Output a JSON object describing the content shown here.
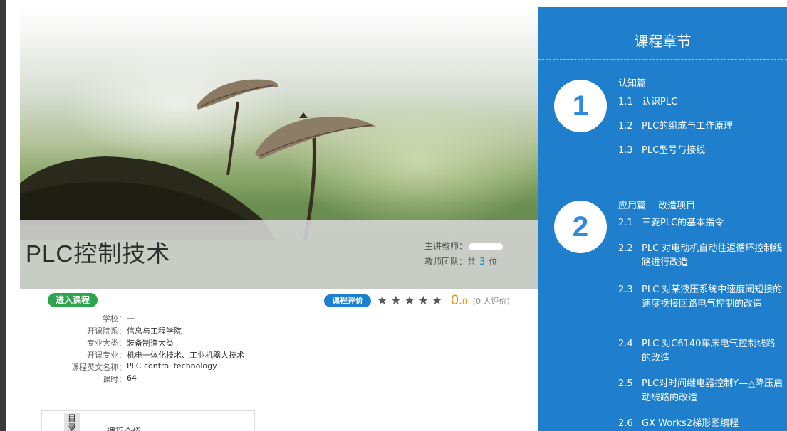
{
  "course": {
    "title": "PLC控制技术",
    "teacher_label": "主讲教师：",
    "team_prefix": "教师团队：共",
    "team_count": "3",
    "team_suffix": "位",
    "enter_label": "进入课程"
  },
  "rating": {
    "badge": "课程评价",
    "stars": "★★★★★",
    "score_main": "0.",
    "score_decimal": "0",
    "count": "(0 人评价)"
  },
  "info": {
    "school_label": "学校：",
    "school_value": "一",
    "dept_label": "开课院系：",
    "dept_value": "信息与工程学院",
    "category_label": "专业大类：",
    "category_value": "装备制造大类",
    "major_label": "开课专业：",
    "major_value": "机电一体化技术、工业机器人技术",
    "english_label": "课程英文名称：",
    "english_value": "PLC control technology",
    "hours_label": "课时：",
    "hours_value": "64"
  },
  "toc": {
    "tab_label": "目录",
    "intro_label": "课程介绍"
  },
  "chapters": {
    "heading": "课程章节",
    "sections": [
      {
        "number": "1",
        "title": "认知篇",
        "items": [
          {
            "no": "1.1",
            "text": "认识PLC"
          },
          {
            "no": "1.2",
            "text": "PLC的组成与工作原理"
          },
          {
            "no": "1.3",
            "text": "PLC型号与接线"
          }
        ]
      },
      {
        "number": "2",
        "title": "应用篇 —改造项目",
        "items": [
          {
            "no": "2.1",
            "text": "三菱PLC的基本指令"
          },
          {
            "no": "2.2",
            "text": "PLC 对电动机自动往返循环控制线路进行改造"
          },
          {
            "no": "2.3",
            "text": "PLC 对某液压系统中速度阀短接的速度换接回路电气控制的改造"
          },
          {
            "no": "2.4",
            "text": "PLC 对C6140车床电气控制线路的改造"
          },
          {
            "no": "2.5",
            "text": "PLC对时间继电器控制Y—△降压启动线路的改造"
          },
          {
            "no": "2.6",
            "text": "GX Works2梯形图编程"
          }
        ]
      }
    ]
  }
}
